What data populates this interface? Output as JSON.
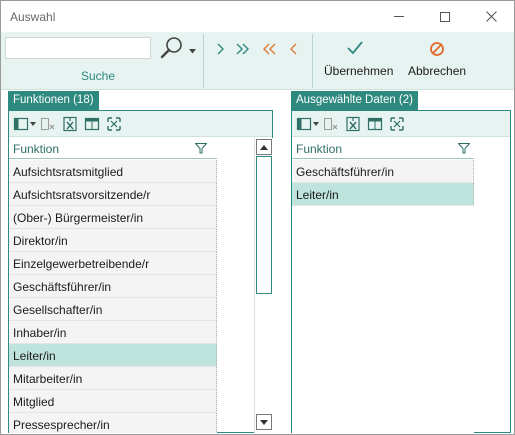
{
  "window": {
    "title": "Auswahl"
  },
  "ribbon": {
    "search": {
      "value": "",
      "placeholder": "",
      "group_label": "Suche"
    },
    "ok_label": "Übernehmen",
    "cancel_label": "Abbrechen",
    "colors": {
      "accent": "#2e8a7e",
      "nav_forward": "#2e8a7e",
      "nav_back": "#e07a3a",
      "cancel": "#e06a2a"
    }
  },
  "left_panel": {
    "tab_label": "Funktionen (18)",
    "column_header": "Funktion",
    "rows": [
      "Aufsichtsratsmitglied",
      "Aufsichtsratsvorsitzende/r",
      "(Ober-) Bürgermeister/in",
      "Direktor/in",
      "Einzelgewerbetreibende/r",
      "Geschäftsführer/in",
      "Gesellschafter/in",
      "Inhaber/in",
      "Leiter/in",
      "Mitarbeiter/in",
      "Mitglied",
      "Pressesprecher/in"
    ],
    "selected_row": "Leiter/in"
  },
  "right_panel": {
    "tab_label": "Ausgewählte Daten (2)",
    "column_header": "Funktion",
    "rows": [
      "Geschäftsführer/in",
      "Leiter/in"
    ],
    "selected_row": "Leiter/in"
  }
}
